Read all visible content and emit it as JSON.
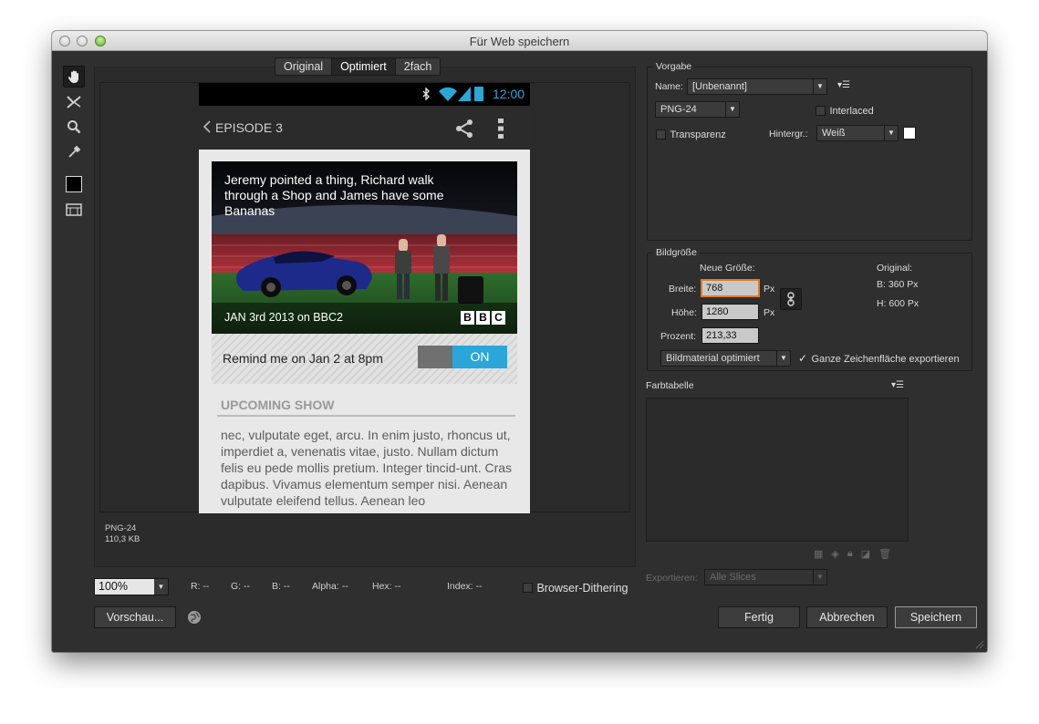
{
  "window": {
    "title": "Für Web speichern"
  },
  "tabs": [
    "Original",
    "Optimiert",
    "2fach"
  ],
  "file_info": {
    "format": "PNG-24",
    "size": "110,3 KB"
  },
  "phone": {
    "time": "12:00",
    "back_title": "EPISODE 3",
    "card_title": "Jeremy pointed a thing, Richard walk through a Shop and James have some Bananas",
    "card_date": "JAN 3rd 2013 on BBC2",
    "bbc": [
      "B",
      "B",
      "C"
    ],
    "remind_text": "Remind me on Jan 2 at 8pm",
    "toggle_label": "ON",
    "upcoming": "UPCOMING SHOW",
    "lorem": "nec, vulputate eget, arcu. In enim justo, rhoncus ut, imperdiet a, venenatis vitae, justo. Nullam dictum felis eu pede mollis pretium. Integer tincid-unt. Cras dapibus. Vivamus elementum semper nisi. Aenean vulputate eleifend tellus. Aenean leo"
  },
  "bottom": {
    "zoom": "100%",
    "r": "R: --",
    "g": "G: --",
    "b": "B: --",
    "alpha": "Alpha: --",
    "hex": "Hex: --",
    "index": "Index: --",
    "dithering": "Browser-Dithering",
    "preview_button": "Vorschau..."
  },
  "buttons": {
    "done": "Fertig",
    "cancel": "Abbrechen",
    "save": "Speichern"
  },
  "preset": {
    "title": "Vorgabe",
    "name_label": "Name:",
    "name_value": "[Unbenannt]",
    "format": "PNG-24",
    "interlaced": "Interlaced",
    "transparency": "Transparenz",
    "matte_label": "Hintergr.:",
    "matte_value": "Weiß"
  },
  "image_size": {
    "title": "Bildgröße",
    "new_size": "Neue Größe:",
    "width_label": "Breite:",
    "width_value": "768",
    "height_label": "Höhe:",
    "height_value": "1280",
    "percent_label": "Prozent:",
    "percent_value": "213,33",
    "unit": "Px",
    "original_label": "Original:",
    "original_w": "B:   360 Px",
    "original_h": "H:   600 Px",
    "quality": "Bildmaterial optimiert",
    "export_artboard": "Ganze Zeichenfläche exportieren"
  },
  "color_table": {
    "title": "Farbtabelle"
  },
  "export": {
    "label": "Exportieren:",
    "value": "Alle Slices"
  }
}
